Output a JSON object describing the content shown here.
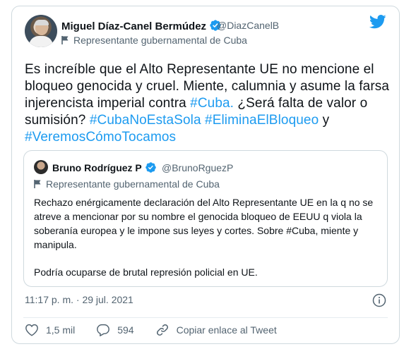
{
  "tweet": {
    "author": {
      "name": "Miguel Díaz-Canel Bermúdez",
      "handle": "@DiazCanelB",
      "label": "Representante gubernamental de Cuba"
    },
    "text": {
      "p1": "Es increíble que el Alto Representante UE no mencione el bloqueo genocida y cruel. Miente, calumnia y asume la farsa injerencista imperial contra ",
      "tag1": "#Cuba.",
      "p2": " ¿Será falta de valor o sumisión? ",
      "tag2": "#CubaNoEstaSola",
      "tag3": "#EliminaElBloqueo",
      "p3": " y ",
      "tag4": "#VeremosCómoTocamos"
    },
    "timestamp": "11:17 p. m. · 29 jul. 2021",
    "likes": "1,5 mil",
    "replies": "594",
    "copy_link": "Copiar enlace al Tweet"
  },
  "quoted": {
    "name": "Bruno Rodríguez P",
    "handle": "@BrunoRguezP",
    "label": "Representante gubernamental de Cuba",
    "text_p1": "Rechazo enérgicamente declaración del Alto Representante UE en la q no se atreve a mencionar por su nombre el genocida bloqueo de EEUU q viola la soberanía europea y le impone sus leyes y cortes. Sobre #Cuba, miente y manipula.",
    "text_p2": "Podría ocuparse de brutal represión policial en UE."
  },
  "colors": {
    "accent": "#1d9bf0",
    "secondary_text": "#536471",
    "border": "#cfd9de"
  },
  "icons": [
    "twitter-bird-icon",
    "verified-badge-icon",
    "flag-icon",
    "info-icon",
    "heart-icon",
    "reply-icon",
    "link-icon"
  ]
}
